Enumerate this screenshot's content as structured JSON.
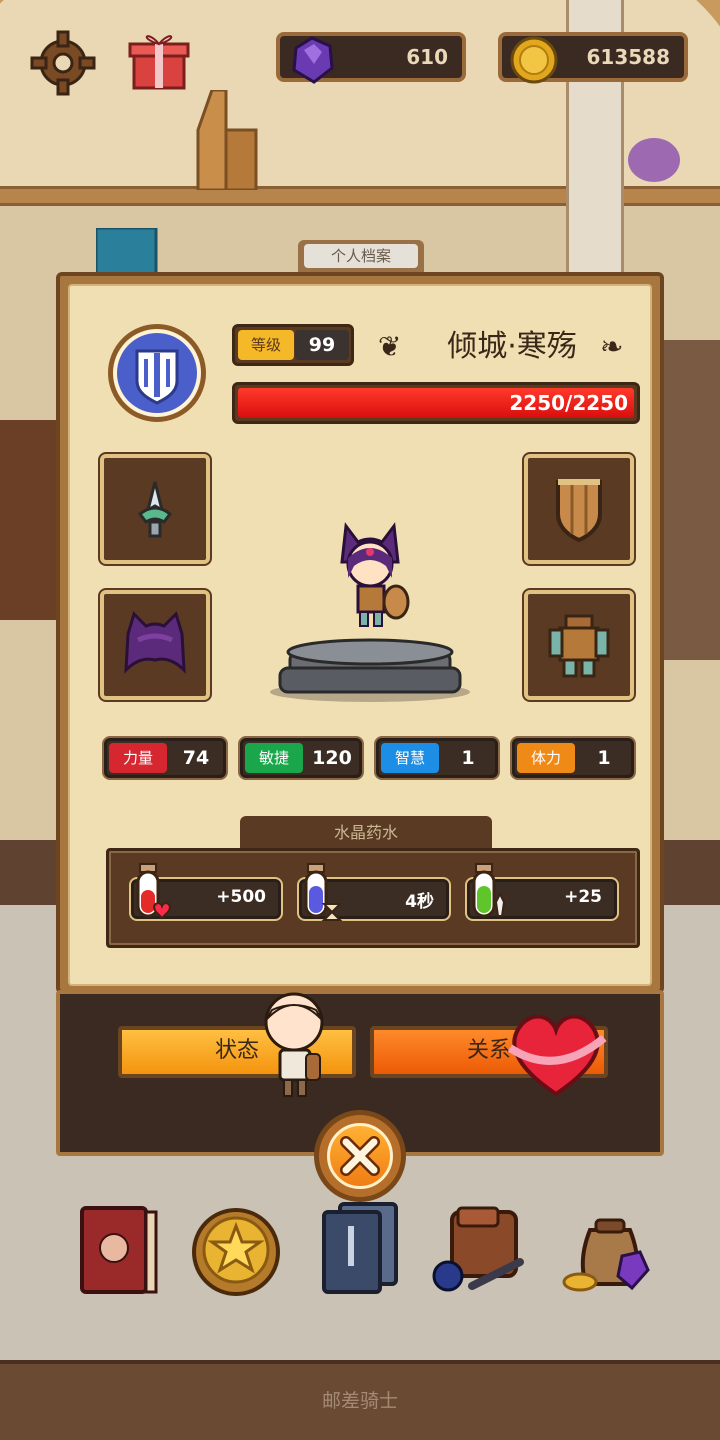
{
  "hud": {
    "settings_icon": "gear-icon",
    "gift_icon": "gift-box-icon",
    "gems": "610",
    "coins": "613588"
  },
  "profile_tab": "个人档案",
  "hero": {
    "level_label": "等级",
    "level": "99",
    "name": "倾城·寒殇",
    "hp_text": "2250/2250",
    "hp_fraction": 1.0
  },
  "equipment": {
    "weapon": "spear-tip-icon",
    "shield": "wooden-shield-icon",
    "helmet": "cat-ear-hood-icon",
    "armor": "leather-armor-icon"
  },
  "stats": [
    {
      "label": "力量",
      "value": "74",
      "color": "#d6262f"
    },
    {
      "label": "敏捷",
      "value": "120",
      "color": "#1aa64a"
    },
    {
      "label": "智慧",
      "value": "1",
      "color": "#1c8ee6"
    },
    {
      "label": "体力",
      "value": "1",
      "color": "#f08a16"
    }
  ],
  "potions": {
    "title": "水晶药水",
    "items": [
      {
        "value": "+500",
        "icon": "red-potion-heart-icon"
      },
      {
        "value": "4秒",
        "icon": "blue-potion-hourglass-icon"
      },
      {
        "value": "+25",
        "icon": "green-potion-sword-icon"
      }
    ]
  },
  "dialog": {
    "status_label": "状态",
    "relation_label": "关系",
    "close_icon": "close-icon"
  },
  "nav": {
    "items": [
      "journal-book-icon",
      "star-medal-icon",
      "card-deck-icon",
      "backpack-icon",
      "treasure-bag-icon"
    ]
  },
  "footer": {
    "title": "邮差骑士"
  },
  "colors": {
    "panel_bg": "#f1dfb4",
    "frame": "#a8773f",
    "hp_red": "#e31b1b",
    "status_button": "#f8a51b",
    "relation_button": "#f16a0f"
  }
}
